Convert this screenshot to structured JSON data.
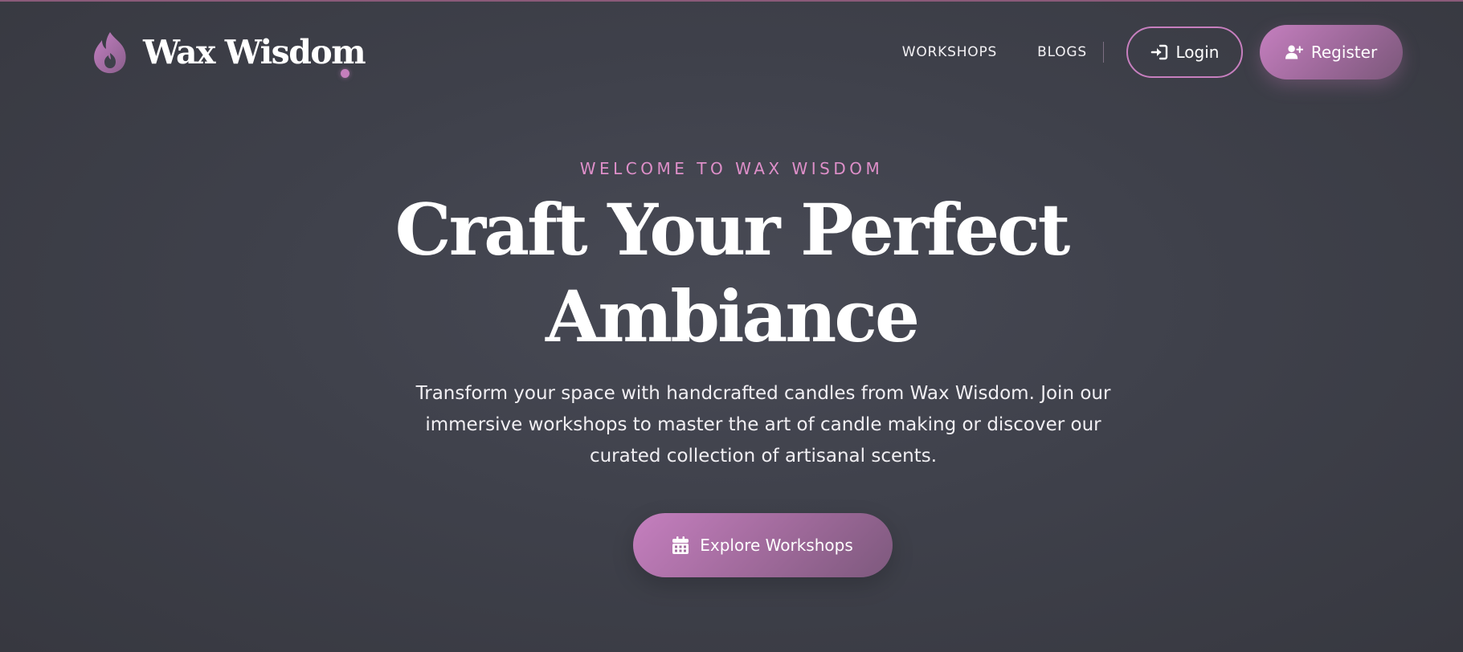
{
  "brand": {
    "name": "Wax Wisdom",
    "logo_icon": "flame-icon",
    "accent_color": "#c57fbc",
    "background_color": "#3f414b"
  },
  "nav": {
    "links": [
      {
        "label": "WORKSHOPS"
      },
      {
        "label": "BLOGS"
      }
    ],
    "login": {
      "label": "Login",
      "icon": "sign-in-icon"
    },
    "register": {
      "label": "Register",
      "icon": "user-plus-icon"
    }
  },
  "hero": {
    "eyebrow": "WELCOME TO WAX WISDOM",
    "title_line1": "Craft Your Perfect",
    "title_line2": "Ambiance",
    "description": "Transform your space with handcrafted candles from Wax Wisdom. Join our immersive workshops to master the art of candle making or discover our curated collection of artisanal scents.",
    "cta": {
      "label": "Explore Workshops",
      "icon": "calendar-icon"
    }
  }
}
